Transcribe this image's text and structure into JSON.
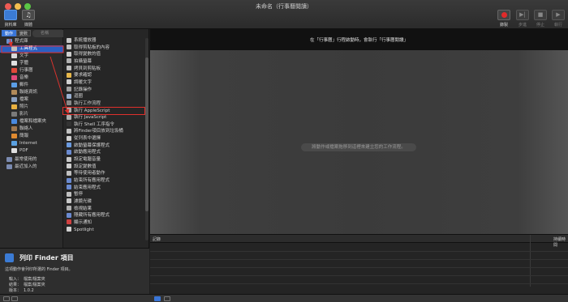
{
  "window": {
    "title": "未命名（行事曆閱讀）"
  },
  "toolbar": {
    "library_label": "資料庫",
    "media_label": "媒體",
    "record_label": "錄製",
    "step_label": "步進",
    "stop_label": "停止",
    "run_label": "執行"
  },
  "library": {
    "tabs": [
      "動作",
      "變數"
    ],
    "search_placeholder": "名稱",
    "items": [
      {
        "label": "程式庫",
        "icon": "folder-icon",
        "color": "#6a8fd0"
      },
      {
        "label": "工具程式",
        "icon": "tools-icon",
        "color": "#c0c0c0",
        "selected": true
      },
      {
        "label": "文字",
        "icon": "text-icon",
        "color": "#d9d9d9"
      },
      {
        "label": "字體",
        "icon": "font-icon",
        "color": "#e0e0e0"
      },
      {
        "label": "行事曆",
        "icon": "calendar-icon",
        "color": "#e04a3a"
      },
      {
        "label": "音樂",
        "icon": "music-icon",
        "color": "#e24a7a"
      },
      {
        "label": "郵件",
        "icon": "mail-icon",
        "color": "#5b9ee6"
      },
      {
        "label": "聯絡資訊",
        "icon": "contacts-icon",
        "color": "#b08a5a"
      },
      {
        "label": "檔案",
        "icon": "files-icon",
        "color": "#8aa0c0"
      },
      {
        "label": "照片",
        "icon": "photos-icon",
        "color": "#e8b040"
      },
      {
        "label": "影片",
        "icon": "movie-icon",
        "color": "#7a7a7a"
      },
      {
        "label": "檔案和檔案夾",
        "icon": "finder-icon",
        "color": "#4a8ae0"
      },
      {
        "label": "聯絡人",
        "icon": "address-icon",
        "color": "#a07850"
      },
      {
        "label": "簡報",
        "icon": "presentation-icon",
        "color": "#e08a30"
      },
      {
        "label": "Internet",
        "icon": "internet-icon",
        "color": "#5aa0e0"
      },
      {
        "label": "PDF",
        "icon": "pdf-icon",
        "color": "#e0e0e0"
      },
      {
        "label": "最常使用的",
        "icon": "frequent-icon",
        "color": "#7a8ab0"
      },
      {
        "label": "最近加入的",
        "icon": "recent-icon",
        "color": "#7a8ab0"
      }
    ]
  },
  "actions": {
    "items": [
      {
        "label": "系統播放器",
        "icon": "speaker-icon",
        "color": "#c8c8c8"
      },
      {
        "label": "取得剪貼板的內容",
        "icon": "clipboard-icon",
        "color": "#c0c0c0"
      },
      {
        "label": "取得變數的值",
        "icon": "variable-icon",
        "color": "#cfcfcf"
      },
      {
        "label": "拍攝螢幕",
        "icon": "screenshot-icon",
        "color": "#b0b0b0"
      },
      {
        "label": "拷貝到剪貼板",
        "icon": "copy-icon",
        "color": "#c0c0c0"
      },
      {
        "label": "要求確認",
        "icon": "confirm-icon",
        "color": "#e8b84a"
      },
      {
        "label": "調暖文字",
        "icon": "text-icon",
        "color": "#d0d0d0"
      },
      {
        "label": "記錄操作",
        "icon": "log-icon",
        "color": "#a0a0a0"
      },
      {
        "label": "迴圈",
        "icon": "loop-icon",
        "color": "#9ab0d0"
      },
      {
        "label": "執行工作流程",
        "icon": "workflow-icon",
        "color": "#8a8a8a"
      },
      {
        "label": "執行 AppleScript",
        "icon": "applescript-icon",
        "color": "#b0b0b0",
        "highlighted": true
      },
      {
        "label": "執行 JavaScript",
        "icon": "javascript-icon",
        "color": "#b0b0b0"
      },
      {
        "label": "執行 Shell 工序指令",
        "icon": "shell-icon",
        "color": "#333333"
      },
      {
        "label": "將Finder項目放到垃圾桶",
        "icon": "trash-icon",
        "color": "#c0c0c0"
      },
      {
        "label": "從列表中選擇",
        "icon": "list-icon",
        "color": "#d0d0d0"
      },
      {
        "label": "啟動螢幕保護程式",
        "icon": "screensaver-icon",
        "color": "#6a9ae0"
      },
      {
        "label": "啟動應用程式",
        "icon": "launch-icon",
        "color": "#6a8ad0"
      },
      {
        "label": "設定電腦音量",
        "icon": "volume-icon",
        "color": "#c8c8c8"
      },
      {
        "label": "設定變數值",
        "icon": "setvar-icon",
        "color": "#cfcfcf"
      },
      {
        "label": "等待使用者動作",
        "icon": "wait-icon",
        "color": "#c0c0c0"
      },
      {
        "label": "結束所有應用程式",
        "icon": "quit-all-icon",
        "color": "#6a8ad0"
      },
      {
        "label": "結束應用程式",
        "icon": "quit-icon",
        "color": "#6a8ad0"
      },
      {
        "label": "暫停",
        "icon": "pause-icon",
        "color": "#c0c0c0"
      },
      {
        "label": "濾鏡光碟",
        "icon": "disc-icon",
        "color": "#c8c8c8"
      },
      {
        "label": "檢視結果",
        "icon": "results-icon",
        "color": "#b0b0b0"
      },
      {
        "label": "隱藏所有應用程式",
        "icon": "hide-icon",
        "color": "#6a8ad0"
      },
      {
        "label": "顯示通知",
        "icon": "notification-icon",
        "color": "#d04040"
      },
      {
        "label": "Spotlight",
        "icon": "spotlight-icon",
        "color": "#d0d0d0"
      }
    ]
  },
  "workflow": {
    "header_text": "在「行事曆」行程啟動時，會執行「行事曆閱讀」",
    "drop_hint": "將動作或檔案拖移到這裡來建立您的工作流程。"
  },
  "log": {
    "col_log": "記錄",
    "col_duration": "持續時間"
  },
  "description": {
    "title": "列印 Finder 項目",
    "text": "這項動作會列印所選的 Finder 項目。",
    "input_key": "輸入：",
    "input_value": "檔案/檔案夾",
    "result_key": "結果：",
    "result_value": "檔案/檔案夾",
    "version_key": "版本：",
    "version_value": "1.0.2"
  },
  "colors": {
    "accent": "#3a76d8",
    "highlight_box": "#e0302c",
    "arrow": "#d8332e"
  }
}
